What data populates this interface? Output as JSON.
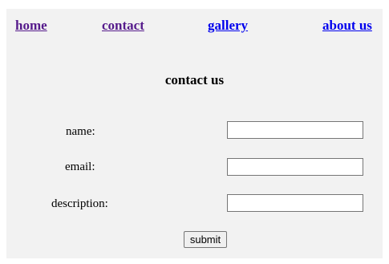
{
  "nav": {
    "items": [
      {
        "label": "home",
        "state": "visited"
      },
      {
        "label": "contact",
        "state": "visited"
      },
      {
        "label": "gallery",
        "state": "unvisited"
      },
      {
        "label": "about us",
        "state": "unvisited"
      }
    ]
  },
  "main": {
    "heading": "contact us"
  },
  "form": {
    "name_label": "name:",
    "name_value": "",
    "email_label": "email:",
    "email_value": "",
    "description_label": "description:",
    "description_value": "",
    "submit_label": "submit"
  },
  "colors": {
    "background": "#f2f2f2",
    "link_visited": "#551a8b",
    "link_unvisited": "#0000ee"
  }
}
